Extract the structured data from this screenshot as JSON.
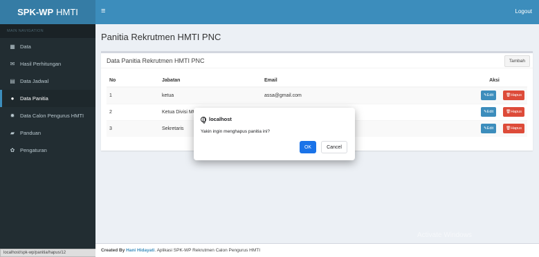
{
  "brand": {
    "bold": "SPK-WP",
    "rest": "HMTI"
  },
  "topbar": {
    "toggle_icon": "≡",
    "logout": "Logout"
  },
  "sidebar": {
    "header": "MAIN NAVIGATION",
    "items": [
      {
        "icon": "table-icon",
        "glyph": "▦",
        "label": "Data"
      },
      {
        "icon": "envelope-icon",
        "glyph": "✉",
        "label": "Hasil Perhitungan"
      },
      {
        "icon": "calendar-icon",
        "glyph": "▤",
        "label": "Data Jadwal"
      },
      {
        "icon": "user-icon",
        "glyph": "●",
        "label": "Data Panitia"
      },
      {
        "icon": "users-icon",
        "glyph": "✹",
        "label": "Data Calon Pengurus HMTI"
      },
      {
        "icon": "book-icon",
        "glyph": "▰",
        "label": "Panduan"
      },
      {
        "icon": "gear-icon",
        "glyph": "✿",
        "label": "Pengaturan"
      }
    ]
  },
  "status_url": "localhost/spk-wp/panitia/hapus/12",
  "page_title": "Panitia Rekrutmen HMTI PNC",
  "box": {
    "title": "Data Panitia Rekrutmen HMTI PNC",
    "tambah": "Tambah",
    "columns": [
      "No",
      "Jabatan",
      "Email",
      "Aksi"
    ],
    "rows": [
      {
        "no": "1",
        "jabatan": "ketua",
        "email": "assa@gmail.com"
      },
      {
        "no": "2",
        "jabatan": "Ketua Divisi MU",
        "email": ""
      },
      {
        "no": "3",
        "jabatan": "Sekretaris",
        "email": ""
      }
    ],
    "edit_label": "✎Edit",
    "hapus_label": "🗑Hapus"
  },
  "dialog": {
    "origin": "localhost",
    "message": "Yakin ingin menghapus panitia ini?",
    "ok": "OK",
    "cancel": "Cancel"
  },
  "footer": {
    "prefix": "Created By",
    "author": "Hani Hidayati",
    "suffix": ". Aplikasi SPK-WP Rekrutmen Calon Pengurus HMTI"
  },
  "watermark": "Activate Windows",
  "colors": {
    "primary": "#3c8dbc",
    "danger": "#dd4b39",
    "sidebar": "#222d32"
  }
}
